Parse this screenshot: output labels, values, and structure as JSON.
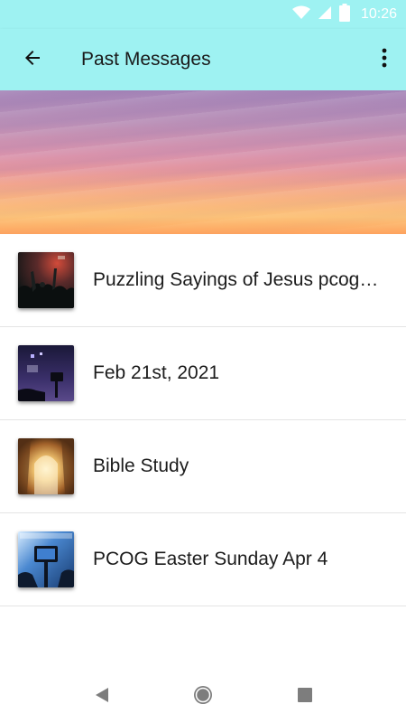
{
  "status_bar": {
    "time": "10:26",
    "icons": [
      "wifi-icon",
      "cell-signal-icon",
      "battery-icon"
    ]
  },
  "app_bar": {
    "title": "Past Messages",
    "back_icon": "arrow-back-icon",
    "menu_icon": "more-vert-icon",
    "background_color": "#9ef2f2"
  },
  "messages": [
    {
      "title": "Puzzling Sayings of Jesus pcog…",
      "thumbnail": "concert-worship-thumbnail"
    },
    {
      "title": "Feb 21st, 2021",
      "thumbnail": "stage-camera-thumbnail"
    },
    {
      "title": "Bible Study",
      "thumbnail": "empty-tomb-thumbnail"
    },
    {
      "title": "PCOG Easter Sunday Apr 4",
      "thumbnail": "camera-recording-thumbnail"
    }
  ],
  "nav_bar": {
    "icons": [
      "back-triangle-icon",
      "home-circle-icon",
      "recents-square-icon"
    ]
  }
}
